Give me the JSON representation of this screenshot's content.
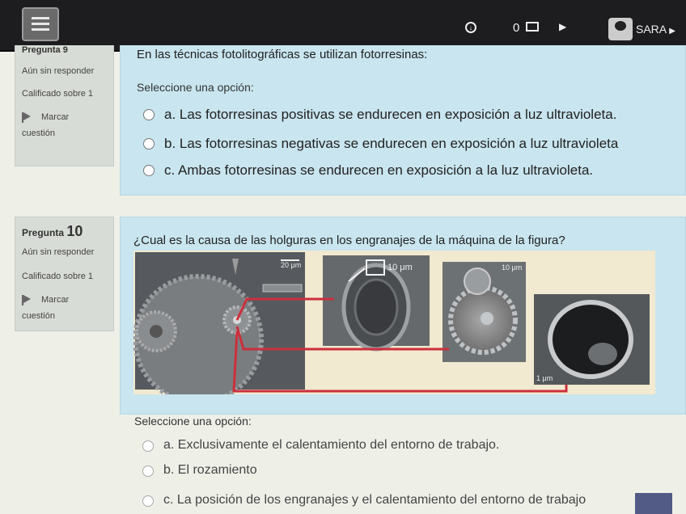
{
  "navbar": {
    "count": "0",
    "user_name": "SARA"
  },
  "question9": {
    "number_label": "Pregunta",
    "number": "9",
    "status": "Aún sin responder",
    "grading": "Calificado sobre 1",
    "flag_label_1": "Marcar",
    "flag_label_2": "cuestión",
    "text": "En las técnicas fotolitográficas se utilizan fotorresinas:",
    "prompt": "Seleccione una opción:",
    "options": [
      "a. Las fotorresinas positivas se endurecen en exposición a luz ultravioleta.",
      "b. Las fotorresinas negativas se endurecen en exposición a luz ultravioleta",
      "c. Ambas fotorresinas se endurecen en exposición a la luz ultravioleta."
    ]
  },
  "question10": {
    "number_label": "Pregunta",
    "number": "10",
    "status": "Aún sin responder",
    "grading": "Calificado sobre 1",
    "flag_label_1": "Marcar",
    "flag_label_2": "cuestión",
    "text": "¿Cual es la causa de las holguras en los engranajes de la máquina de la figura?",
    "figure": {
      "scale_1": "20 μm",
      "scale_2": "10 μm",
      "scale_3": "10 μm",
      "scale_4": "1 μm"
    },
    "prompt": "Seleccione una opción:",
    "options": [
      "a. Exclusivamente el calentamiento del entorno de trabajo.",
      "b. El rozamiento",
      "c. La posición de los engranajes y el calentamiento del entorno de trabajo"
    ]
  }
}
